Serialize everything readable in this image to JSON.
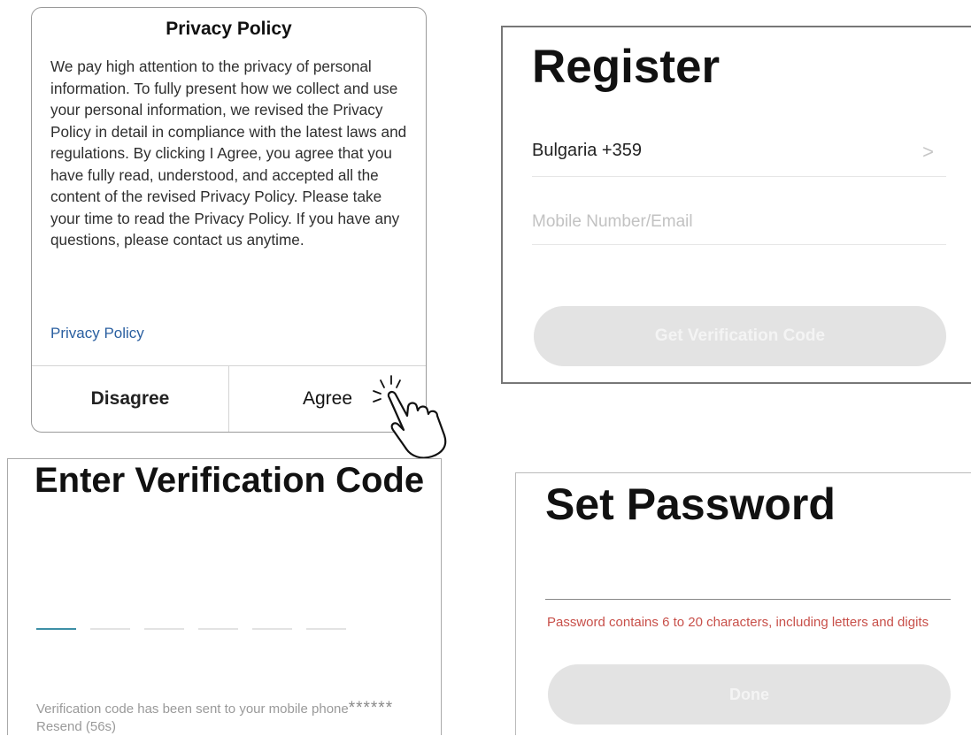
{
  "privacy_dialog": {
    "title": "Privacy Policy",
    "body": "We pay high attention to the privacy of personal information. To fully present how we collect and use your personal information, we revised the Privacy Policy in detail in compliance with the latest laws and regulations. By clicking I Agree, you agree that you have fully read, understood, and accepted all the content of the revised Privacy Policy. Please take your time to read the Privacy Policy. If you have any questions, please contact us anytime.",
    "link_label": "Privacy Policy",
    "disagree_label": "Disagree",
    "agree_label": "Agree"
  },
  "register": {
    "title": "Register",
    "country_label": "Bulgaria +359",
    "chevron": ">",
    "mobile_placeholder": "Mobile Number/Email",
    "button_label": "Get Verification Code"
  },
  "verification": {
    "title": "Enter Verification Code",
    "code_length": 6,
    "message_prefix": "Verification code has been sent to your mobile phone",
    "masked_number": "******",
    "resend_label": "Resend (56s)"
  },
  "set_password": {
    "title": "Set Password",
    "hint": "Password contains 6 to 20 characters, including letters and digits",
    "done_label": "Done"
  },
  "colors": {
    "link": "#2a5fa0",
    "hint_error": "#c8504a",
    "disabled_button": "#e3e3e3",
    "active_slot": "#3d8fa6"
  }
}
